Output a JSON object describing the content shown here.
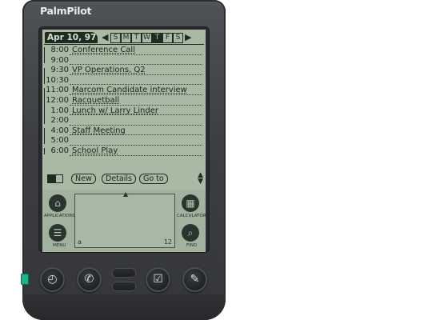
{
  "device": {
    "brand": "PalmPilot"
  },
  "header": {
    "date": "Apr 10, 97",
    "prev_arrow": "◀",
    "next_arrow": "▶",
    "days": [
      "S",
      "M",
      "T",
      "W",
      "T",
      "F",
      "S"
    ],
    "selected_day_index": 4
  },
  "schedule": [
    {
      "time": "8:00",
      "desc": "Conference Call"
    },
    {
      "time": "9:00",
      "desc": ""
    },
    {
      "time": "9:30",
      "desc": "VP Operations, Q2"
    },
    {
      "time": "10:30",
      "desc": ""
    },
    {
      "time": "11:00",
      "desc": "Marcom Candidate interview"
    },
    {
      "time": "12:00",
      "desc": "Racquetball"
    },
    {
      "time": "1:00",
      "desc": "Lunch w/ Larry Linder"
    },
    {
      "time": "2:00",
      "desc": ""
    },
    {
      "time": "4:00",
      "desc": "Staff Meeting"
    },
    {
      "time": "5:00",
      "desc": ""
    },
    {
      "time": "6:00",
      "desc": "School Play"
    }
  ],
  "toolbar": {
    "new_label": "New",
    "details_label": "Details",
    "goto_label": "Go to",
    "scroll_up": "▲",
    "scroll_down": "▼"
  },
  "silkscreen": {
    "applications_label": "APPLICATIONS",
    "menu_label": "MENU",
    "calculator_label": "CALCULATOR",
    "find_label": "FIND",
    "graffiti_abc": "a",
    "graffiti_num": "12"
  },
  "colors": {
    "screen": "#a9b9a4",
    "ink": "#1f2b22",
    "power": "#1db38c",
    "body": "#3c3e41"
  }
}
